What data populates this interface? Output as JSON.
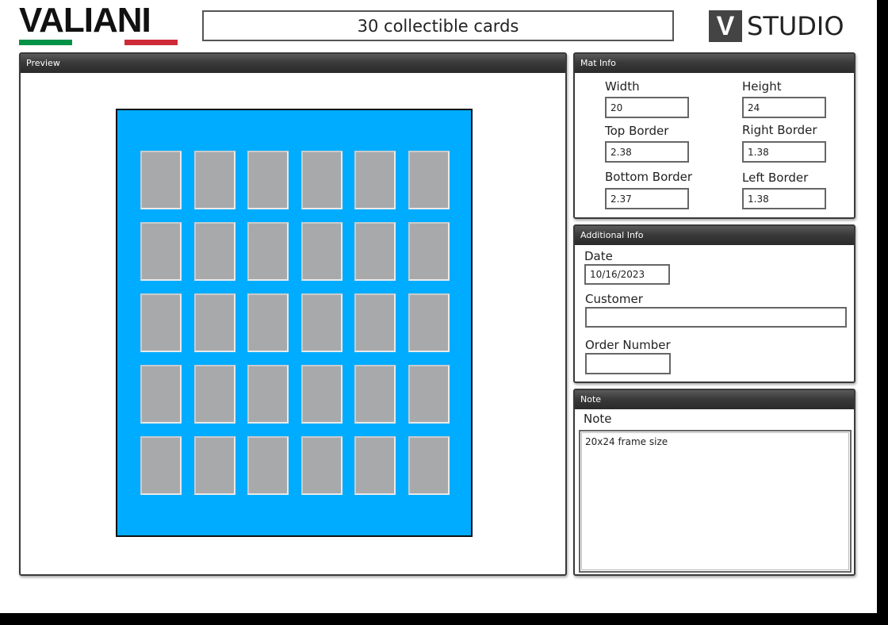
{
  "header": {
    "logo_text": "VALIANI",
    "flag_colors": [
      "#009246",
      "#ffffff",
      "#ce2b37"
    ],
    "title": "30 collectible cards",
    "studio_mark": "V",
    "studio_text": "STUDIO"
  },
  "preview": {
    "header": "Preview",
    "mat_color": "#00acff",
    "opening_color": "#a7a9ab",
    "rows": 5,
    "columns": 6
  },
  "mat_info": {
    "header": "Mat Info",
    "width_label": "Width",
    "width_value": "20",
    "height_label": "Height",
    "height_value": "24",
    "top_border_label": "Top Border",
    "top_border_value": "2.38",
    "right_border_label": "Right Border",
    "right_border_value": "1.38",
    "bottom_border_label": "Bottom Border",
    "bottom_border_value": "2.37",
    "left_border_label": "Left Border",
    "left_border_value": "1.38"
  },
  "additional_info": {
    "header": "Additional Info",
    "date_label": "Date",
    "date_value": "10/16/2023",
    "customer_label": "Customer",
    "customer_value": "",
    "order_label": "Order Number",
    "order_value": ""
  },
  "note": {
    "header": "Note",
    "label": "Note",
    "value": "20x24 frame size"
  }
}
